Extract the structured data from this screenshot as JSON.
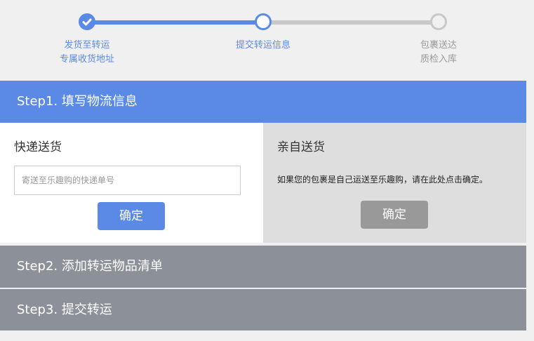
{
  "progress": {
    "steps": [
      {
        "line1": "发货至转运",
        "line2": "专属收货地址",
        "state": "done"
      },
      {
        "line1": "提交转运信息",
        "line2": "",
        "state": "current"
      },
      {
        "line1": "包裹送达",
        "line2": "质检入库",
        "state": "pending"
      }
    ],
    "colors": {
      "active": "#5b8ae6",
      "inactive": "#c8c8c8",
      "pending_text": "#999999"
    }
  },
  "step1": {
    "title": "Step1. 填写物流信息",
    "express": {
      "title": "快递送货",
      "placeholder": "寄送至乐趣购的快递单号",
      "value": "",
      "confirm": "确定"
    },
    "self": {
      "title": "亲自送货",
      "description": "如果您的包裹是自己运送至乐趣购，请在此处点击确定。",
      "confirm": "确定"
    }
  },
  "step2": {
    "title": "Step2. 添加转运物品清单"
  },
  "step3": {
    "title": "Step3. 提交转运"
  }
}
